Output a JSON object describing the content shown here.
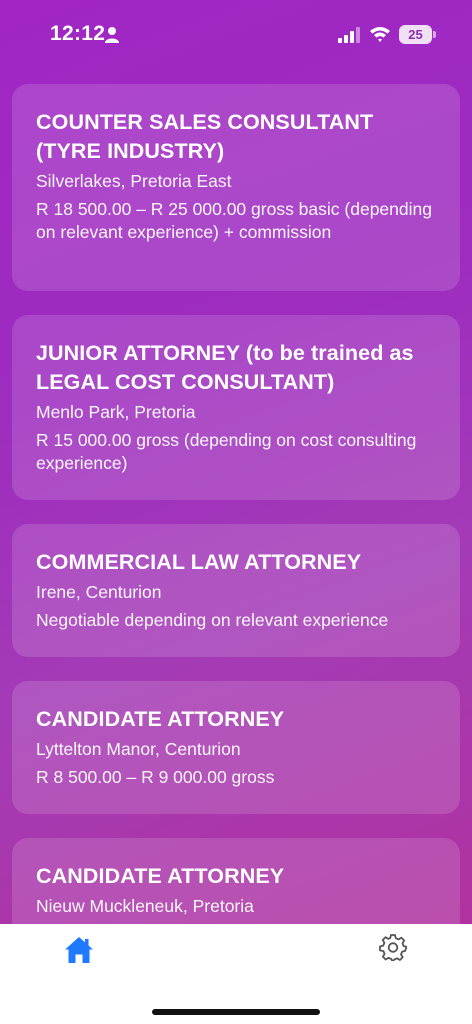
{
  "status_bar": {
    "time": "12:12",
    "battery": "25"
  },
  "jobs": [
    {
      "title": "COUNTER SALES CONSULTANT (TYRE INDUSTRY)",
      "location": "Silverlakes, Pretoria East",
      "salary": "R 18 500.00 – R 25 000.00 gross basic (depending on relevant experience) + commission"
    },
    {
      "title": "JUNIOR ATTORNEY (to be trained as LEGAL COST CONSULTANT)",
      "location": "Menlo Park, Pretoria",
      "salary": "R 15 000.00 gross (depending on cost consulting experience)"
    },
    {
      "title": "COMMERCIAL LAW ATTORNEY",
      "location": "Irene, Centurion",
      "salary": "Negotiable depending on relevant experience"
    },
    {
      "title": "CANDIDATE ATTORNEY",
      "location": "Lyttelton Manor, Centurion",
      "salary": "R 8 500.00 – R 9 000.00 gross"
    },
    {
      "title": "CANDIDATE ATTORNEY",
      "location": "Nieuw Muckleneuk, Pretoria",
      "salary": ""
    }
  ],
  "tab_bar": {
    "tabs": [
      {
        "icon": "home-icon",
        "active": true
      },
      {
        "icon": "gear-icon",
        "active": false
      }
    ],
    "active_color": "#1f7aff",
    "inactive_color": "#555555"
  }
}
